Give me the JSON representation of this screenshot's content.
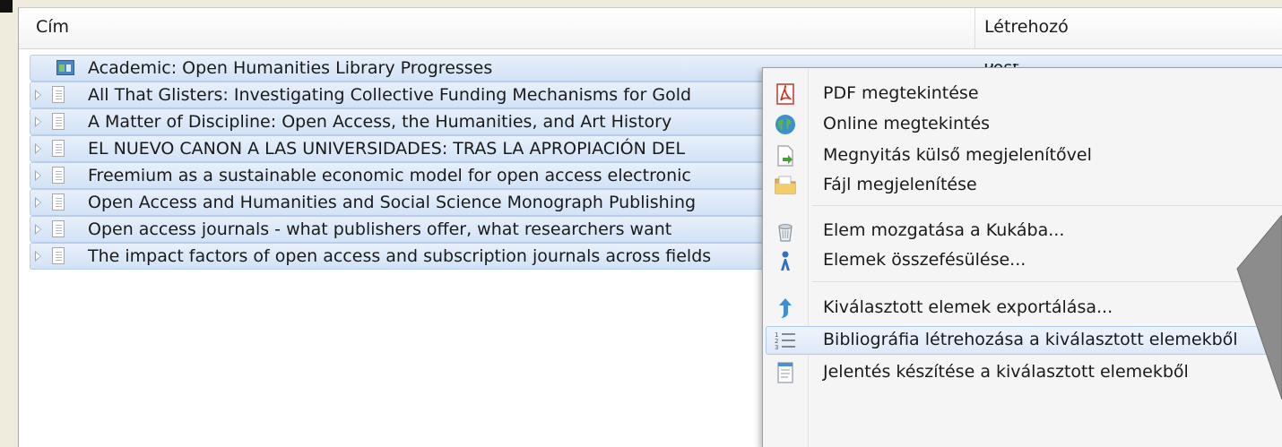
{
  "columns": {
    "title_header": "Cím",
    "creator_header": "Létrehozó"
  },
  "creator_partial": "Post",
  "items": [
    {
      "title": "Academic: Open Humanities Library Progresses",
      "icon": "webpage-icon"
    },
    {
      "title": "All That Glisters: Investigating Collective Funding Mechanisms for Gold",
      "icon": "document-icon"
    },
    {
      "title": "A Matter of Discipline: Open Access, the Humanities, and Art History",
      "icon": "document-icon"
    },
    {
      "title": "EL NUEVO CANON A LAS UNIVERSIDADES: TRAS LA APROPIACIÓN DEL",
      "icon": "document-icon"
    },
    {
      "title": "Freemium as a sustainable economic model for open access electronic",
      "icon": "document-icon"
    },
    {
      "title": "Open Access and Humanities and Social Science Monograph Publishing",
      "icon": "document-icon"
    },
    {
      "title": "Open access journals - what publishers offer, what researchers want",
      "icon": "document-icon"
    },
    {
      "title": "The impact factors of open access and subscription journals across fields",
      "icon": "document-icon"
    }
  ],
  "context_menu": {
    "items": [
      {
        "label": "PDF megtekintése",
        "icon": "pdf-icon"
      },
      {
        "label": "Online megtekintés",
        "icon": "globe-icon"
      },
      {
        "label": "Megnyitás külső megjelenítővel",
        "icon": "open-external-icon"
      },
      {
        "label": "Fájl megjelenítése",
        "icon": "folder-icon"
      },
      {
        "label": "Elem mozgatása a Kukába...",
        "icon": "trash-icon"
      },
      {
        "label": "Elemek összefésülése...",
        "icon": "merge-icon"
      },
      {
        "label": "Kiválasztott elemek exportálása...",
        "icon": "export-icon"
      },
      {
        "label": "Bibliográfia létrehozása a kiválasztott elemekből",
        "icon": "bibliography-icon",
        "highlighted": true
      },
      {
        "label": "Jelentés készítése a kiválasztott elemekből",
        "icon": "report-icon"
      }
    ]
  },
  "colors": {
    "selection": "#d2e2f6",
    "selection_border": "#b7cde9",
    "menu_bg": "#f5f5f5",
    "highlight_border": "#aecbee"
  }
}
